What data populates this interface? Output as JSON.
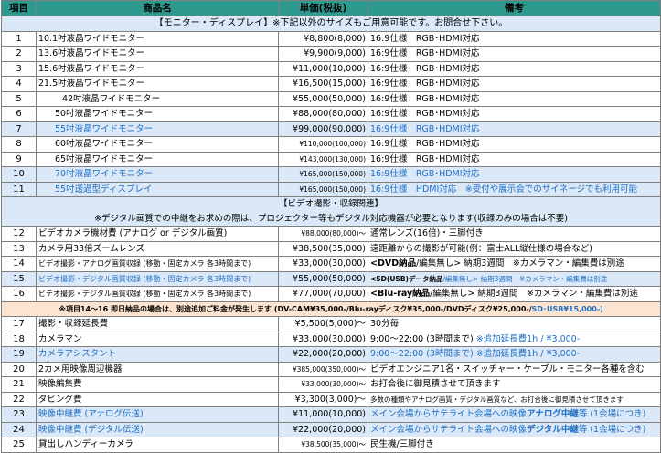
{
  "header": {
    "no": "項目",
    "name": "商品名",
    "price": "単価(税抜)",
    "note": "備考"
  },
  "section1": {
    "title": "【モニター・ディスプレイ】",
    "note": "※下記以外のサイズもご用意可能です。お問合せ下さい。"
  },
  "monitors": [
    {
      "no": "1",
      "name": "10.1吋液晶ワイドモニター",
      "price": "¥8,800(8,000)",
      "note": "16:9仕様　RGB･HDMI対応"
    },
    {
      "no": "2",
      "name": "13.6吋液晶ワイドモニター",
      "price": "¥9,900(9,000)",
      "note": "16:9仕様　RGB･HDMI対応"
    },
    {
      "no": "3",
      "name": "15.6吋液晶ワイドモニター",
      "price": "¥11,000(10,000)",
      "note": "16:9仕様　RGB･HDMI対応"
    },
    {
      "no": "4",
      "name": "21.5吋液晶ワイドモニター",
      "price": "¥16,500(15,000)",
      "note": "16:9仕様　RGB･HDMI対応"
    },
    {
      "no": "5",
      "name": "42吋液晶ワイドモニター",
      "price": "¥55,000(50,000)",
      "note": "16:9仕様　RGB･HDMI対応"
    },
    {
      "no": "6",
      "name": "50吋液晶ワイドモニター",
      "price": "¥88,000(80,000)",
      "note": "16:9仕様　RGB･HDMI対応"
    },
    {
      "no": "7",
      "name": "55吋液晶ワイドモニター",
      "price": "¥99,000(90,000)",
      "note": "16:9仕様　RGB･HDMI対応"
    },
    {
      "no": "8",
      "name": "60吋液晶ワイドモニター",
      "price": "¥110,000(100,000)",
      "note": "16:9仕様　RGB･HDMI対応"
    },
    {
      "no": "9",
      "name": "65吋液晶ワイドモニター",
      "price": "¥143,000(130,000)",
      "note": "16:9仕様　RGB･HDMI対応"
    },
    {
      "no": "10",
      "name": "70吋液晶ワイドモニター",
      "price": "¥165,000(150,000)",
      "note": "16:9仕様　RGB･HDMI対応"
    },
    {
      "no": "11",
      "name": "55吋透過型ディスプレイ",
      "price": "¥165,000(150,000)",
      "note": "16:9仕様　HDMI対応　※受付や展示会でのサイネージでも利用可能"
    }
  ],
  "section2": {
    "title": "【ビデオ撮影・収録関連】",
    "note": "※デジタル画質での中継をお求めの際は、プロジェクター等もデジタル対応機器が必要となります(収録のみの場合は不要)"
  },
  "video": [
    {
      "no": "12",
      "name": "ビデオカメラ機材費 (アナログ or デジタル画質)",
      "price": "¥88,000(80,000)〜",
      "note": "通常レンズ(16倍)・三脚付き"
    },
    {
      "no": "13",
      "name": "カメラ用33倍ズームレンズ",
      "price": "¥38,500(35,000)",
      "note": "遠距離からの撮影が可能(例：富士ALL縦仕様の場合など)"
    },
    {
      "no": "14",
      "name": "ビデオ撮影・アナログ画質収録 (移動・固定カメラ 各3時間まで)",
      "price": "¥33,000(30,000)",
      "note_a": "<DVD納品",
      "note_b": "/編集無し> 納期3週間　※カメラマン・編集費は別途"
    },
    {
      "no": "15",
      "name": "ビデオ撮影・デジタル画質収録 (移動・固定カメラ 各3時間まで)",
      "price": "¥55,000(50,000)",
      "note_a": "<SD(USB)データ納品",
      "note_b": "/編集無し> 納期3週間　※カメラマン・編集費は別途"
    },
    {
      "no": "16",
      "name": "ビデオ撮影・デジタル画質収録 (移動・固定カメラ 各3時間まで)",
      "price": "¥77,000(70,000)",
      "note_a": "<Blu-ray納品",
      "note_b": "/編集無し> 納期3週間　※カメラマン・編集費は別途"
    }
  ],
  "notice": {
    "text": "※項目14〜16 即日納品の場合は、別途追加ご料金が発生します (DV-CAM¥35,000-/Blu-rayディスク¥35,000-/DVDディスク¥25,000-/",
    "text_b": "SD･USB¥15,000-)"
  },
  "other": [
    {
      "no": "17",
      "name": "撮影・収録延長費",
      "price": "¥5,500(5,000)〜",
      "note": "30分毎"
    },
    {
      "no": "18",
      "name": "カメラマン",
      "price": "¥33,000(30,000)",
      "note": "9:00〜22:00 (3時間まで)",
      "note_b": "※追加延長費1h / ¥3,000-"
    },
    {
      "no": "19",
      "name": "カメラアシスタント",
      "price": "¥22,000(20,000)",
      "note": "9:00〜22:00 (3時間まで)",
      "note_b": "※追加延長費1h / ¥3,000-"
    },
    {
      "no": "20",
      "name": "2カメ用映像周辺機器",
      "price": "¥385,000(350,000)〜",
      "note": "ビデオエンジニア1名・スイッチャー・ケーブル・モニター各種を含む"
    },
    {
      "no": "21",
      "name": "映像編集費",
      "price": "¥33,000(30,000)〜",
      "note": "お打合後に御見積させて頂きます"
    },
    {
      "no": "22",
      "name": "ダビング費",
      "price": "¥3,300(3,000)〜",
      "note": "多数の種類やアナログ画質・デジタル画質など、お打合後に御見積させて頂きます"
    },
    {
      "no": "23",
      "name": "映像中継費 (アナログ伝送)",
      "price": "¥11,000(10,000)",
      "note_a": "メイン会場からサテライト会場への映像",
      "note_b": "アナログ中継",
      "note_c": "等 (1会場につき)"
    },
    {
      "no": "24",
      "name": "映像中継費 (デジタル伝送)",
      "price": "¥22,000(20,000)",
      "note_a": "メイン会場からサテライト会場への映像",
      "note_b": "デジタル中継",
      "note_c": "等 (1会場につき)"
    },
    {
      "no": "25",
      "name": "貸出しハンディーカメラ",
      "price": "¥38,500(35,000)〜",
      "note": "民生機/三脚付き"
    }
  ],
  "colors": {
    "header_bg": "#2e9a8f",
    "section_bg": "#dae8f8",
    "highlight_text": "#1f6fc4",
    "notice_bg": "#fce4d0"
  }
}
